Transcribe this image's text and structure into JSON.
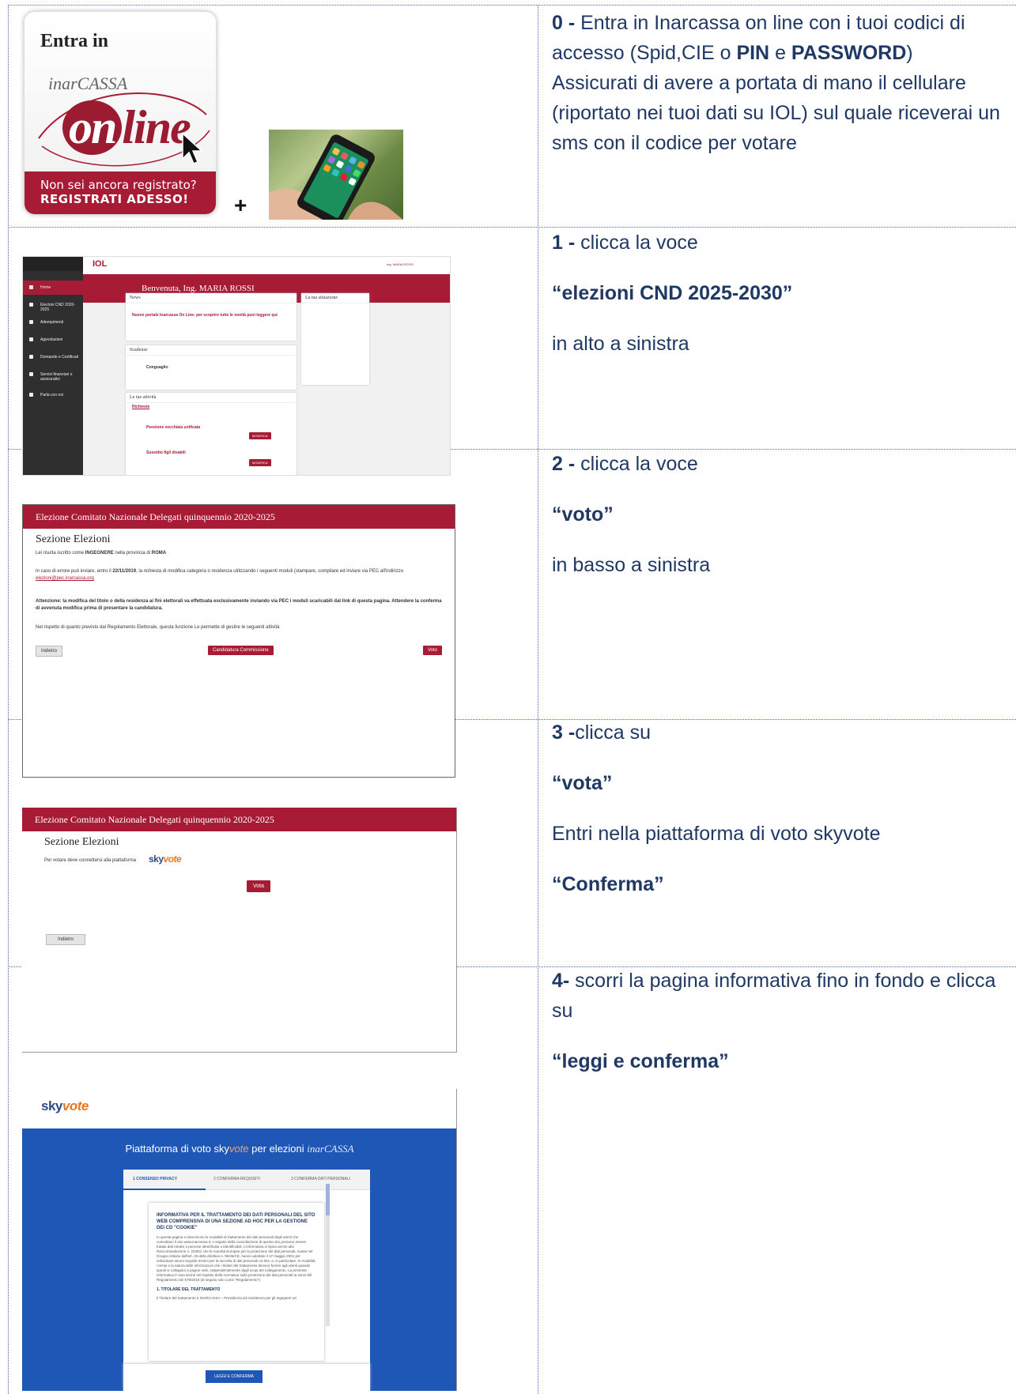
{
  "steps": [
    {
      "num": "0 -",
      "line1": " Entra in Inarcassa on line con i tuoi codici di accesso (Spid,CIE o ",
      "pin": "PIN",
      "e": " e ",
      "password": "PASSWORD",
      "close": ")",
      "line2": "Assicurati di avere a portata di mano il cellulare (riportato nei tuoi dati su IOL) sul quale riceverai un sms con il codice per votare"
    },
    {
      "num": "1 -",
      "text1": " clicca la voce",
      "target": "“elezioni CND 2025-2030”",
      "text2": "in alto a sinistra"
    },
    {
      "num": "2 -",
      "text1": " clicca la voce",
      "target": "“voto”",
      "text2": " in basso a sinistra"
    },
    {
      "num": "3 -",
      "text1": "clicca su",
      "target": "“vota”",
      "text2": "Entri nella piattaforma di voto skyvote",
      "target2": "“Conferma”"
    },
    {
      "num": "4-",
      "text1": " scorri la pagina informativa fino in fondo e clicca su",
      "target": "“leggi e conferma”"
    }
  ],
  "iol_card": {
    "entra": "Entra in",
    "brand": "inarCASSA",
    "on": "on",
    "line": "line",
    "band1": "Non sei ancora registrato?",
    "band2": "REGISTRATI ADESSO!"
  },
  "plus": "+",
  "ss1": {
    "logo": "IOL",
    "welcome": "Benvenuta, Ing. MARIA ROSSI",
    "menu": [
      "Home",
      "Elezioni CND 2020-2025",
      "Adempimenti",
      "Agevolazioni",
      "Domande e Certificati",
      "Servizi finanziari e assicurativi",
      "Parla con noi"
    ],
    "news_title": "News",
    "news_link": "Nuovo portale Inarcassa On Line: per scoprire tutte le novità puoi leggere qui",
    "scad_title": "Scadenze",
    "scad_item": "Conguaglio",
    "sit_title": "La tua situazione",
    "att_title": "Le tue attività",
    "att_tab": "Richieste",
    "att1": "Pensione vecchiaia unificata",
    "att2": "Sussidio figli disabili",
    "btn": "MODIFICA",
    "user": "Ing. MARIA ROSSI"
  },
  "ss2": {
    "bar": "Elezione Comitato Nazionale Delegati quinquennio 2020-2025",
    "section": "Sezione Elezioni",
    "t1a": "Lei risulta iscritto come ",
    "t1b": "INGEGNERE",
    "t1c": " nella provincia di ",
    "t1d": "ROMA",
    "t2a": "In caso di errore può inviare, entro il ",
    "t2b": "22/11/2019",
    "t2c": ", la richiesta di modifica categoria o residenza utilizzando i seguenti moduli (stampare, compilare ed inviare via PEC all'indirizzo",
    "t2link": "elezioni@pec.inarcassa.org",
    "t3": "Attenzione: la modifica del titolo o della residenza ai fini elettorali va effettuata esclusivamente inviando via PEC i moduli scaricabili dal link di questa pagina. Attendere la conferma di avvenuta modifica prima di presentare la candidatura.",
    "t4": "Nel rispetto di quanto previsto dal Regolamento Elettorale, questa funzione Le permette di gestire le seguenti attività",
    "btn_back": "Indietro",
    "btn_cand": "Candidatura Commissione",
    "btn_voto": "Voto"
  },
  "ss3": {
    "bar": "Elezione Comitato Nazionale Delegati quinquennio 2020-2025",
    "section": "Sezione Elezioni",
    "text": "Per votare deve connettersi alla piattaforma",
    "sky1": "sky",
    "sky2": "vote",
    "btn_vota": "Vota",
    "btn_back": "Indietro"
  },
  "ss4": {
    "logo1": "sky",
    "logo2": "vote",
    "title_a": "Piattaforma di voto ",
    "title_sky1": "sky",
    "title_sky2": "vote",
    "title_b": " per elezioni ",
    "title_c": "inarCASSA",
    "tabs": [
      "1 CONSENSO PRIVACY",
      "2 CONFERMA REQUISITI",
      "3 CONFERMA DATI PERSONALI"
    ],
    "doc_head": "INFORMATIVA PER IL TRATTAMENTO DEI DATI PERSONALI DEL SITO WEB COMPRENSIVA DI UNA SEZIONE AD HOC PER LA GESTIONE DEI CD \"COOKIE\"",
    "doc_par": "In questa pagina si descrivono le modalità di trattamento dei dati personali degli utenti che consultano il sito www.inarcassa.it. A seguito della consultazione di questo sito possono essere trattati dati relativi a persone identificate o identificabili. L'informativa si ispira anche alla Raccomandazione n. 2/2001 che le Autorità Europee per la protezione dei dati personali, riunite nel Gruppo istituito dall'art. 29 della direttiva n. 95/46/CE, hanno adottato il 17 maggio 2001 per individuare alcuni requisiti minimi per la raccolta di dati personali on-line, e, in particolare, le modalità, i tempi e la natura delle informazioni che i titolari del trattamento devono fornire agli utenti quando questi si collegano a pagine web, indipendentemente dagli scopi del collegamento. La presente informativa è resa anche nel rispetto della normativa sulla protezione dei dati personali ai sensi del Regolamento UE 679/2016 (di seguito solo come \"Regolamento\").",
    "doc_sub": "1. TITOLARE DEL TRATTAMENTO",
    "doc_par2": "Il Titolare del trattamento è INARCASSA – Previdenza ed Assistenza per gli Ingegneri ed",
    "btn": "LEGGI E CONFERMA"
  }
}
